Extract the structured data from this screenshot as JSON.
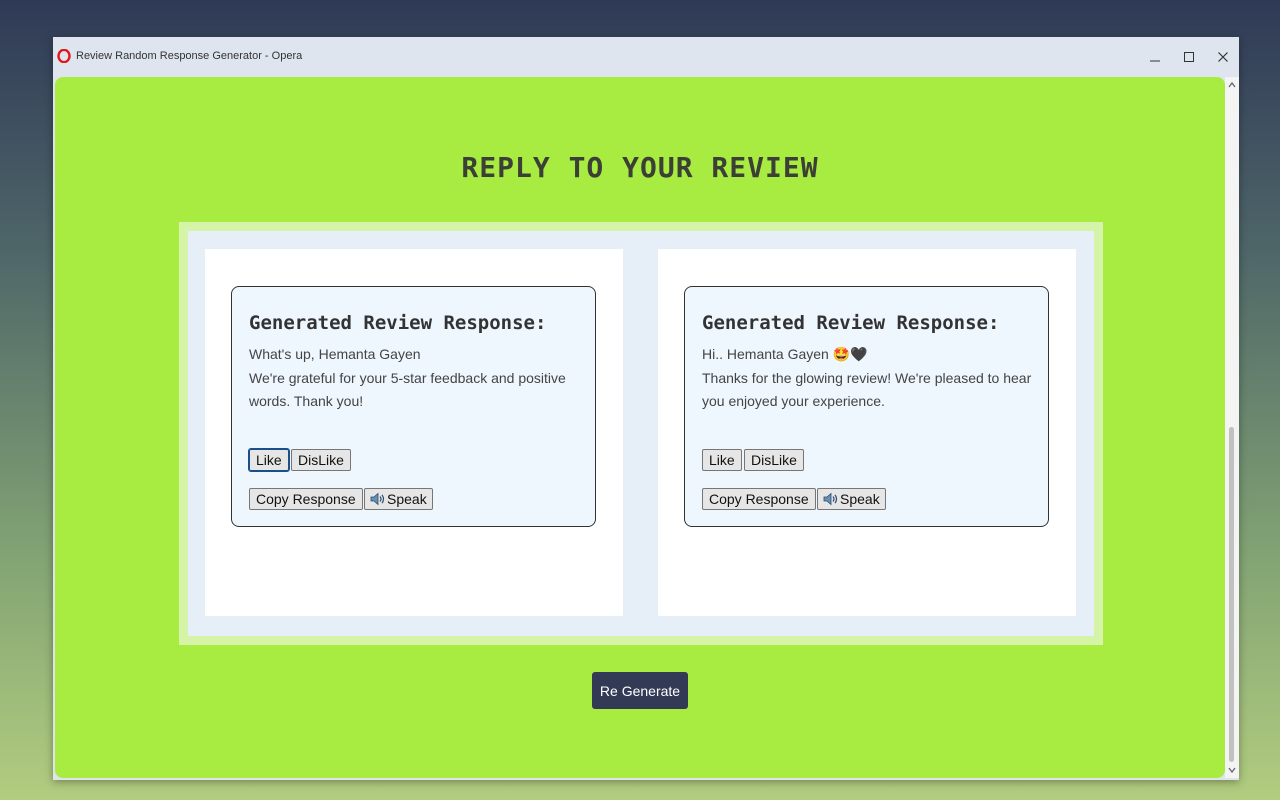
{
  "window": {
    "title": "Review Random Response Generator - Opera",
    "minimize": "_",
    "maximize": "☐",
    "close": "✕"
  },
  "page": {
    "heading": "REPLY TO YOUR REVIEW",
    "regenerate_label": "Re Generate"
  },
  "cards": [
    {
      "title": "Generated Review Response:",
      "greeting": "What's up, Hemanta Gayen",
      "body": "We're grateful for your 5-star feedback and positive words. Thank you!",
      "like_label": "Like",
      "dislike_label": "DisLike",
      "copy_label": "Copy Response",
      "speak_label": "Speak"
    },
    {
      "title": "Generated Review Response:",
      "greeting": "Hi.. Hemanta Gayen 🤩🖤",
      "body": "Thanks for the glowing review! We're pleased to hear you enjoyed your experience.",
      "like_label": "Like",
      "dislike_label": "DisLike",
      "copy_label": "Copy Response",
      "speak_label": "Speak"
    }
  ],
  "colors": {
    "page_background": "#a8ec41",
    "card_background": "#eef6fe",
    "regenerate_button": "#333a56"
  },
  "icons": {
    "browser": "opera-icon",
    "speak": "speaker-icon"
  }
}
